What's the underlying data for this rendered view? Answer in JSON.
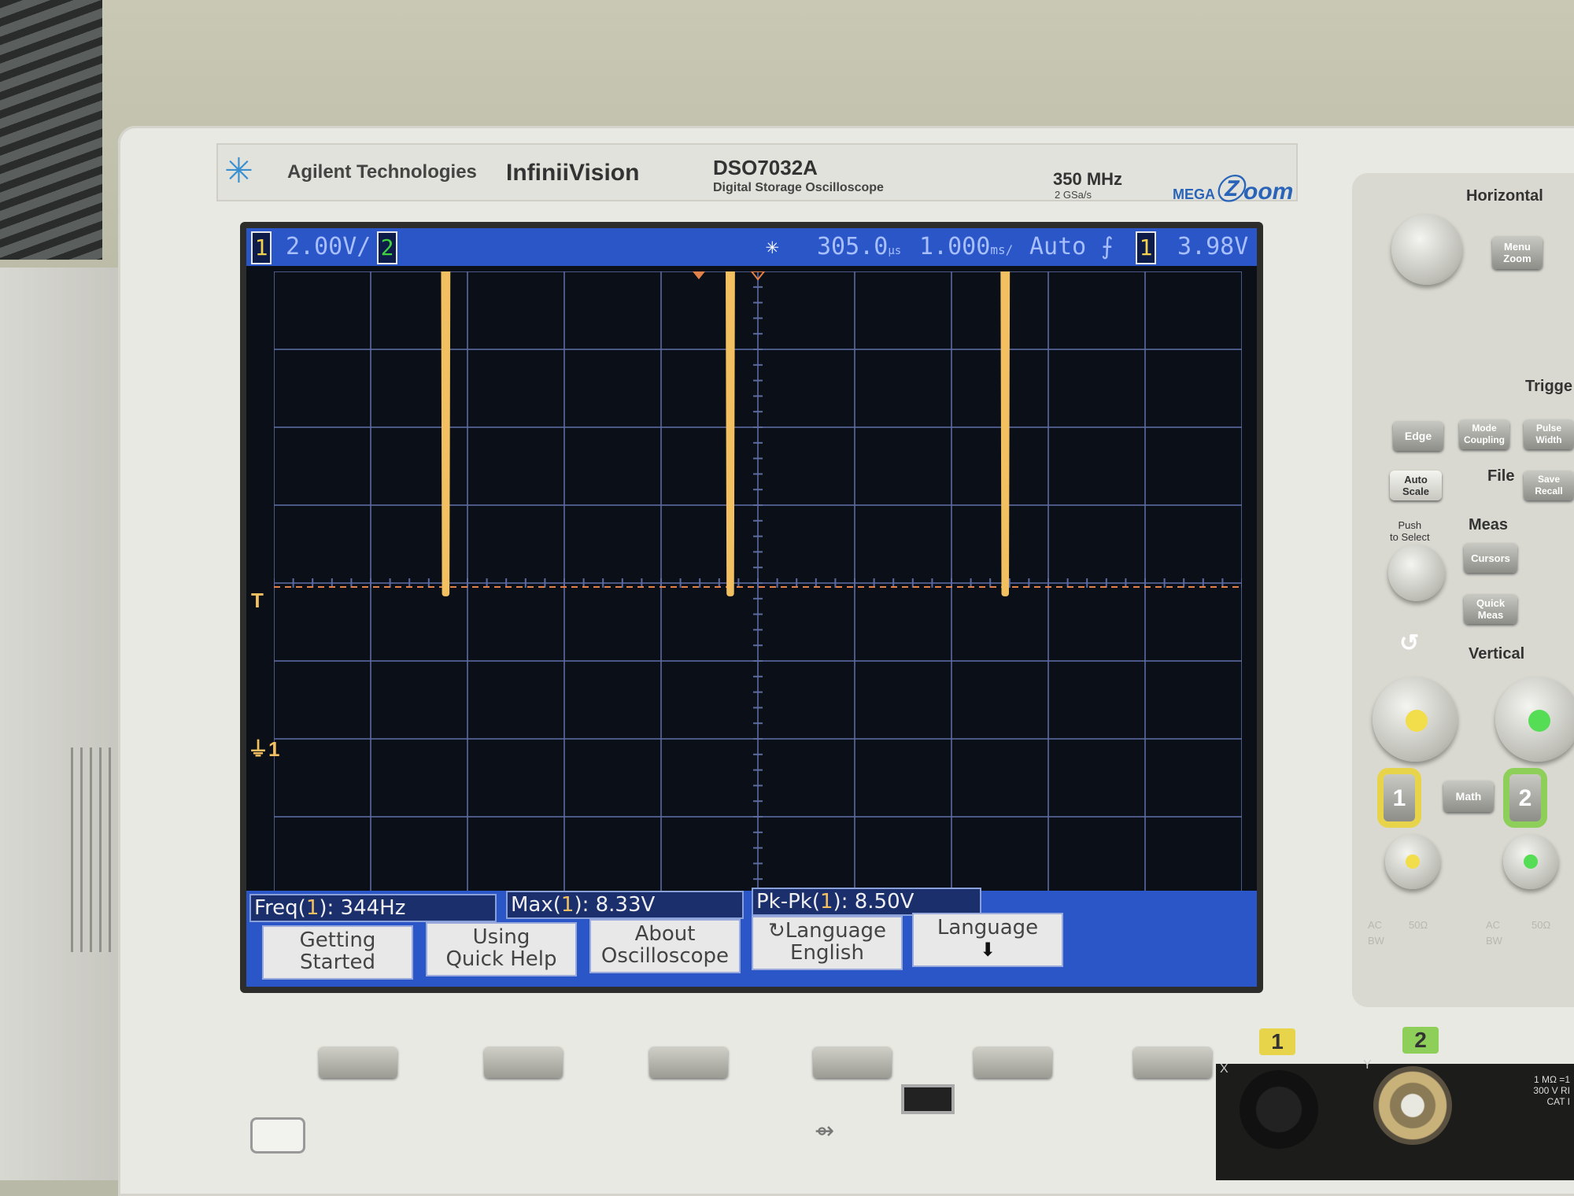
{
  "brand": {
    "company": "Agilent Technologies",
    "series": "InfiniiVision",
    "model": "DSO7032A",
    "description": "Digital Storage Oscilloscope",
    "bandwidth": "350 MHz",
    "sample_rate": "2 GSa/s",
    "feature_logo_prefix": "MEGA",
    "feature_logo_suffix": "oom"
  },
  "status_bar": {
    "ch1_number": "1",
    "ch1_scale": "2.00V/",
    "ch2_number": "2",
    "delay": "305.0",
    "delay_unit": "µs",
    "timebase": "1.000",
    "timebase_unit": "ms/",
    "trigger_mode": "Auto",
    "trigger_slope_icon": "rising-edge-icon",
    "trigger_source": "1",
    "trigger_level": "3.98V"
  },
  "markers": {
    "trigger_level_marker": "T",
    "ground_marker": "1"
  },
  "measurements": [
    {
      "label": "Freq(",
      "ch": "1",
      "suffix": "): 344Hz"
    },
    {
      "label": "Max(",
      "ch": "1",
      "suffix": "): 8.33V"
    },
    {
      "label": "Pk-Pk(",
      "ch": "1",
      "suffix": "): 8.50V"
    }
  ],
  "softkeys": [
    {
      "line1": "Getting",
      "line2": "Started"
    },
    {
      "line1": "Using",
      "line2": "Quick Help"
    },
    {
      "line1": "About",
      "line2": "Oscilloscope"
    },
    {
      "line1": "Language",
      "line2": "English"
    },
    {
      "line1": "Language",
      "line2": ""
    }
  ],
  "panel": {
    "horizontal": "Horizontal",
    "menu_zoom": "Menu\nZoom",
    "trigger": "Trigge",
    "edge": "Edge",
    "mode_coupling": "Mode\nCoupling",
    "pulse_width": "Pulse\nWidth",
    "auto_scale": "Auto\nScale",
    "file": "File",
    "save_recall": "Save\nRecall",
    "push_to_select": "Push\nto Select",
    "meas": "Meas",
    "cursors": "Cursors",
    "quick_meas": "Quick\nMeas",
    "vertical": "Vertical",
    "ch1": "1",
    "math": "Math",
    "ch2": "2",
    "ac": "AC",
    "bw": "BW",
    "ohm50": "50Ω"
  },
  "inputs": {
    "ch1_label": "1",
    "ch2_label": "2",
    "x_label": "X",
    "y_label": "Y",
    "spec": "1 MΩ =1\n300 V RI\nCAT I"
  },
  "colors": {
    "screen_bg": "#0b0f17",
    "bar_blue": "#2a56c8",
    "trace_ch1": "#f2c060",
    "grid": "#5c6aa0",
    "ground_dash": "#e0804a",
    "ch2_green": "#3fd13f"
  },
  "chart_data": {
    "type": "line",
    "title": "",
    "xlabel": "",
    "ylabel": "",
    "x_unit": "ms",
    "y_unit": "V",
    "xlim": [
      -4.695,
      5.305
    ],
    "ylim": [
      -7.9,
      8.1
    ],
    "grid": true,
    "series": [
      {
        "name": "",
        "description_points": true,
        "x": [
          -4.695,
          -2.94,
          -2.93,
          -2.91,
          -2.9,
          0.0,
          0.01,
          0.03,
          0.04,
          2.84,
          2.85,
          2.87,
          2.88,
          5.305
        ],
        "y": [
          8.33,
          8.33,
          -0.17,
          -0.17,
          8.33,
          8.33,
          -0.17,
          -0.17,
          8.33,
          8.33,
          -0.17,
          -0.17,
          8.33,
          8.33
        ]
      }
    ],
    "trigger_level": 3.98,
    "ground_level": 0
  }
}
